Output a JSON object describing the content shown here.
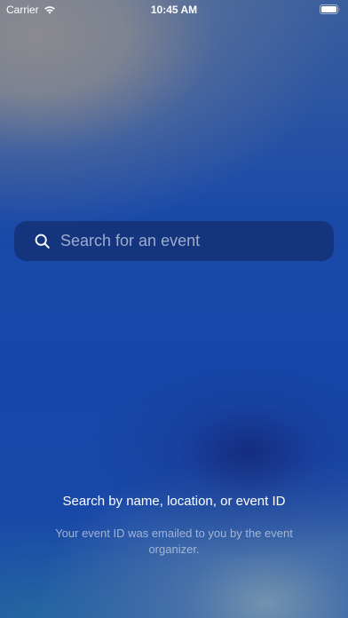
{
  "status_bar": {
    "carrier": "Carrier",
    "time": "10:45 AM"
  },
  "search": {
    "placeholder": "Search for an event",
    "value": ""
  },
  "help": {
    "title": "Search by name, location, or event ID",
    "subtitle": "Your event ID was emailed to you by the event organizer."
  },
  "icons": {
    "wifi": "wifi-icon",
    "battery": "battery-icon",
    "search": "search-icon"
  },
  "colors": {
    "background": "#1748a8",
    "search_field": "#122d6e",
    "text": "#ffffff"
  }
}
